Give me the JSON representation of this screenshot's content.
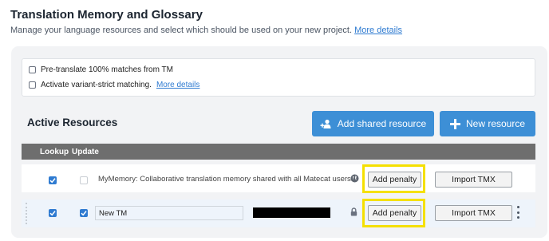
{
  "header": {
    "title": "Translation Memory and Glossary",
    "subtitle": "Manage your language resources and select which should be used on your new project.",
    "more_details": "More details"
  },
  "options": {
    "pretranslate": "Pre-translate 100% matches from TM",
    "variant_strict": "Activate variant-strict matching.",
    "more_details": "More details"
  },
  "active": {
    "title": "Active Resources",
    "add_shared_label": "Add shared resource",
    "new_resource_label": "New resource"
  },
  "table": {
    "headers": {
      "lookup": "Lookup",
      "update": "Update"
    },
    "rows": [
      {
        "lookup_checked": true,
        "update_checked": false,
        "update_disabled": true,
        "name": "MyMemory: Collaborative translation memory shared with all Matecat users.",
        "status_icon": "globe-icon",
        "penalty_label": "Add penalty",
        "import_label": "Import TMX"
      },
      {
        "lookup_checked": true,
        "update_checked": true,
        "name": "New TM",
        "key_redacted": true,
        "status_icon": "lock-icon",
        "penalty_label": "Add penalty",
        "import_label": "Import TMX",
        "menu_icon": "kebab-menu-icon"
      }
    ]
  },
  "colors": {
    "primary_button": "#3d8fd6",
    "table_header": "#6e6e6e",
    "highlight": "#f5e000",
    "link": "#2f7bd1"
  }
}
